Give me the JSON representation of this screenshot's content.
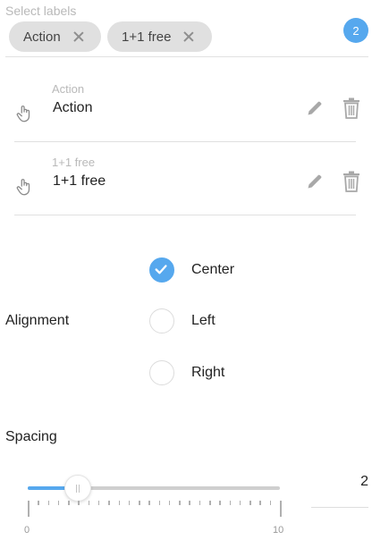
{
  "select": {
    "caption": "Select labels",
    "chips": [
      "Action",
      "1+1 free"
    ],
    "count": "2"
  },
  "labels": [
    {
      "caption": "Action",
      "value": "Action"
    },
    {
      "caption": "1+1 free",
      "value": "1+1 free"
    }
  ],
  "icons": {
    "drag": "hand-pointer-icon",
    "edit": "pencil-icon",
    "delete": "trash-icon",
    "remove_chip": "close-icon",
    "check": "checkmark-icon"
  },
  "alignment": {
    "label": "Alignment",
    "options": [
      "Center",
      "Left",
      "Right"
    ],
    "selected": "Center"
  },
  "spacing": {
    "label": "Spacing",
    "value": "2",
    "min_label": "0",
    "max_label": "10",
    "min": 0,
    "max": 10,
    "current": 2
  },
  "colors": {
    "accent": "#56a8ee",
    "muted_text": "#b9b9b9",
    "chip_bg": "#e0e0e0"
  }
}
